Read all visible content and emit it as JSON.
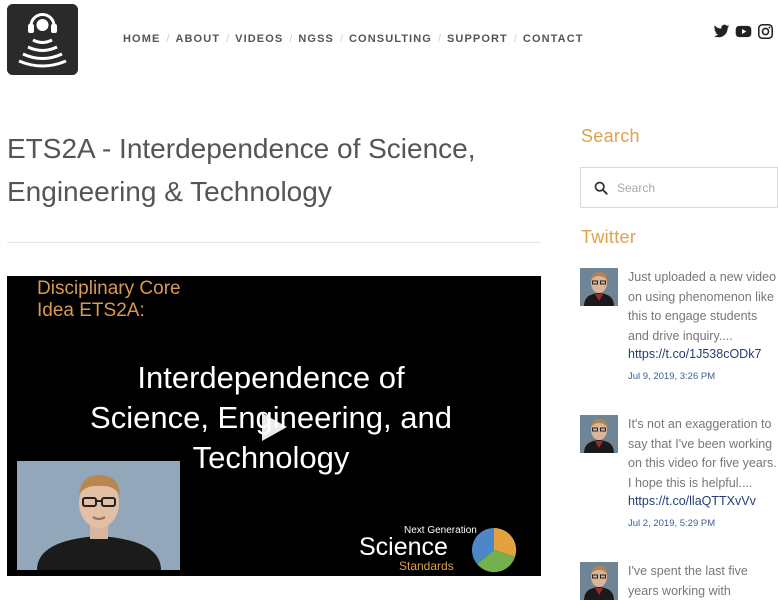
{
  "header": {
    "nav": [
      "HOME",
      "ABOUT",
      "VIDEOS",
      "NGSS",
      "CONSULTING",
      "SUPPORT",
      "CONTACT"
    ],
    "social_icons": [
      "twitter-icon",
      "youtube-icon",
      "instagram-icon"
    ]
  },
  "page": {
    "title_line1": "ETS2A - Interdependence of Science,",
    "title_line2": "Engineering & Technology"
  },
  "video": {
    "heading_line1": "Disciplinary Core",
    "heading_line2": "Idea ETS2A:",
    "main_line1": "Interdependence of",
    "main_line2": "Science, Engineering, and",
    "main_line3": "Technology",
    "badge_top": "Next Generation",
    "badge_main": "Science",
    "badge_bottom": "Standards"
  },
  "sidebar": {
    "search_heading": "Search",
    "search_placeholder": "Search",
    "twitter_heading": "Twitter",
    "tweets": [
      {
        "text": "Just uploaded a new video on using phenomenon like this to engage students and drive inquiry....",
        "link": "https://t.co/1J538cODk7",
        "date": "Jul 9, 2019, 3:26 PM"
      },
      {
        "text": "It's not an exaggeration to say that I've been working on this video for five years. I hope this is helpful....",
        "link": "https://t.co/llaQTTXvVv",
        "date": "Jul 2, 2019, 5:29 PM"
      },
      {
        "text": "I've spent the last five years working with",
        "link": "",
        "date": ""
      }
    ]
  },
  "colors": {
    "accent": "#e0a14a",
    "link": "#233d78",
    "nav_text": "#555555"
  }
}
